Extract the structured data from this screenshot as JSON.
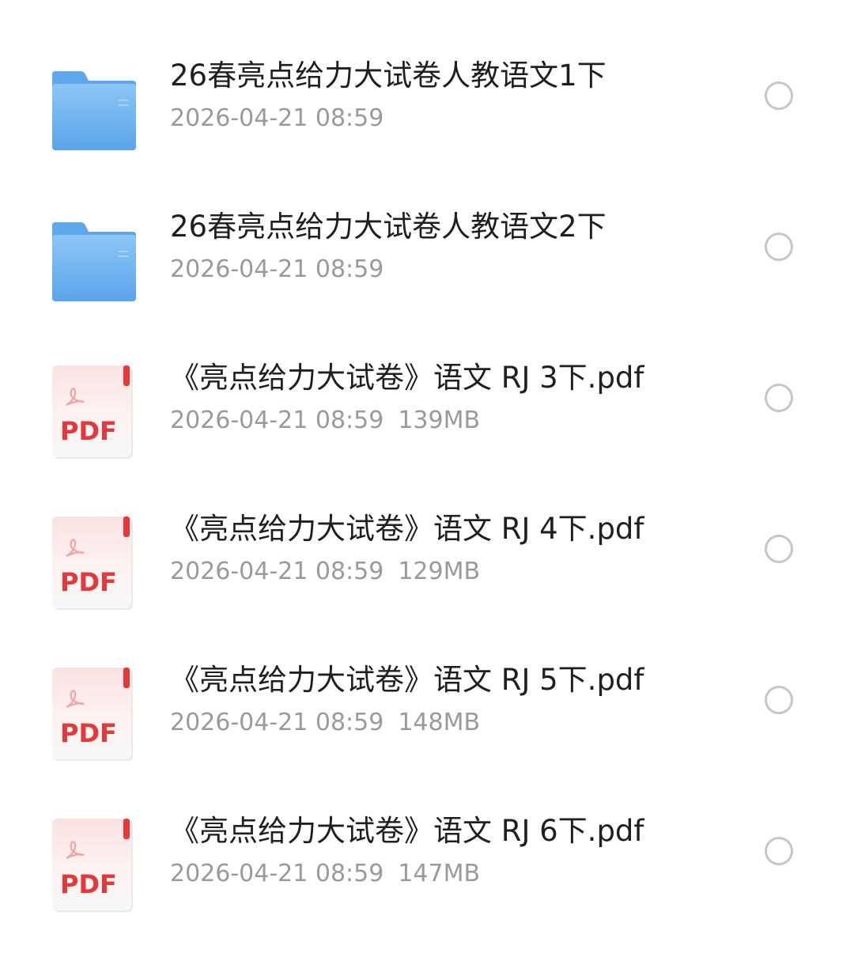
{
  "files": [
    {
      "type": "folder",
      "icon": "folder-icon",
      "name": "26春亮点给力大试卷人教语文1下",
      "date": "2026-04-21 08:59",
      "size": ""
    },
    {
      "type": "folder",
      "icon": "folder-icon",
      "name": "26春亮点给力大试卷人教语文2下",
      "date": "2026-04-21 08:59",
      "size": ""
    },
    {
      "type": "pdf",
      "icon": "pdf-file-icon",
      "name": "《亮点给力大试卷》语文 RJ 3下.pdf",
      "date": "2026-04-21 08:59",
      "size": "139MB"
    },
    {
      "type": "pdf",
      "icon": "pdf-file-icon",
      "name": "《亮点给力大试卷》语文 RJ 4下.pdf",
      "date": "2026-04-21 08:59",
      "size": "129MB"
    },
    {
      "type": "pdf",
      "icon": "pdf-file-icon",
      "name": "《亮点给力大试卷》语文 RJ 5下.pdf",
      "date": "2026-04-21 08:59",
      "size": "148MB"
    },
    {
      "type": "pdf",
      "icon": "pdf-file-icon",
      "name": "《亮点给力大试卷》语文 RJ 6下.pdf",
      "date": "2026-04-21 08:59",
      "size": "147MB"
    }
  ],
  "pdf_icon_label": "PDF",
  "colors": {
    "folder_blue": "#7fbdf3",
    "folder_blue_dark": "#62a8ea",
    "pdf_red": "#e23a3a",
    "text_primary": "#1f1f1f",
    "text_secondary": "#9a9a9a",
    "radio_border": "#c6c6c6"
  }
}
